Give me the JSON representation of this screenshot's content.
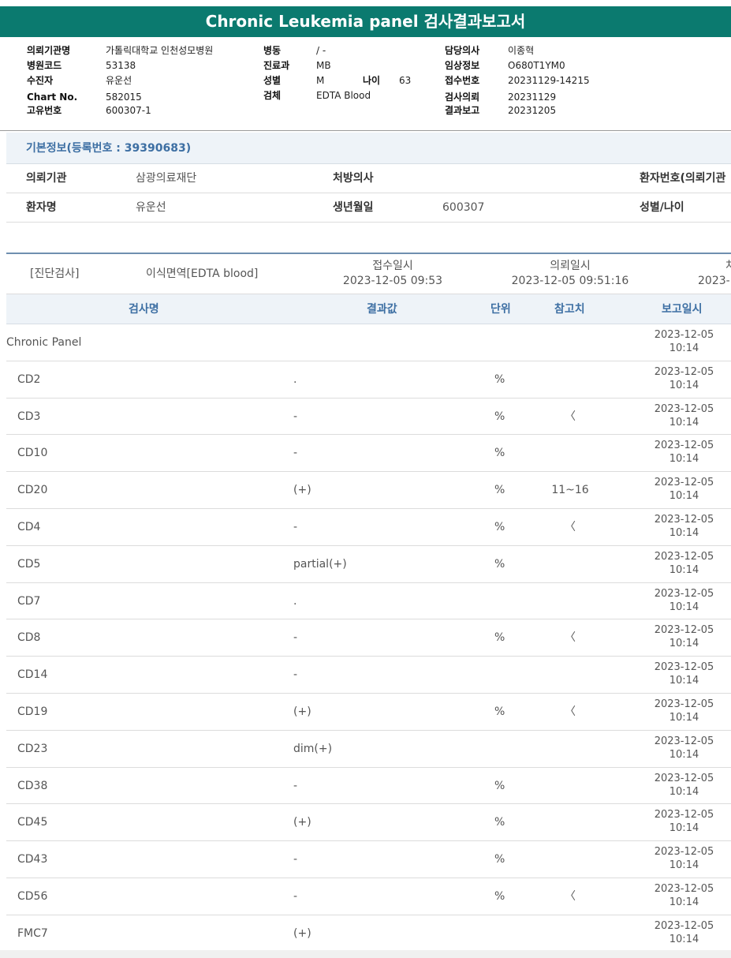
{
  "report_title": "Chronic Leukemia panel 검사결과보고서",
  "header": {
    "col1": [
      {
        "label": "의뢰기관명",
        "value": "가톨릭대학교 인천성모병원"
      },
      {
        "label": "병원코드",
        "value": "53138"
      },
      {
        "label": "수진자",
        "value": "유운선"
      },
      {
        "label": "Chart No.",
        "value": "582015"
      },
      {
        "label": "고유번호",
        "value": "600307-1"
      }
    ],
    "col2": [
      {
        "label": "병동",
        "value": "/ -"
      },
      {
        "label": "진료과",
        "value": "MB"
      },
      {
        "label": "성별",
        "value": "M"
      },
      {
        "label": "검체",
        "value": "EDTA Blood"
      }
    ],
    "age": {
      "label": "나이",
      "value": "63"
    },
    "col3": [
      {
        "label": "담당의사",
        "value": "이종혁"
      },
      {
        "label": "임상정보",
        "value": "O680T1YM0"
      },
      {
        "label": "접수번호",
        "value": "20231129-14215"
      },
      {
        "label": "검사의뢰",
        "value": "20231129"
      },
      {
        "label": "결과보고",
        "value": "20231205"
      }
    ]
  },
  "basic_info": {
    "title": "기본정보(등록번호 : 39390683)",
    "row1": {
      "label1": "의뢰기관",
      "value1": "삼광의료재단",
      "label2": "처방의사",
      "value2": "",
      "label3": "환자번호(의뢰기관"
    },
    "row2": {
      "label1": "환자명",
      "value1": "유운선",
      "label2": "생년월일",
      "value2": "600307",
      "label3": "성별/나이"
    }
  },
  "diagnosis": {
    "category": "[진단검사]",
    "dept": "이식면역[EDTA blood]",
    "received_label": "접수일시",
    "received_value": "2023-12-05 09:53",
    "requested_label": "의뢰일시",
    "requested_value": "2023-12-05 09:51:16",
    "cut_label": "처",
    "cut_value": "2023-"
  },
  "columns": {
    "name": "검사명",
    "value": "결과값",
    "unit": "단위",
    "ref": "참고치",
    "date": "보고일시"
  },
  "rows": [
    {
      "name": "Chronic Panel",
      "value": "",
      "unit": "",
      "ref": "",
      "date": "2023-12-05",
      "time": "10:14",
      "group": true
    },
    {
      "name": "CD2",
      "value": ".",
      "unit": "%",
      "ref": "",
      "date": "2023-12-05",
      "time": "10:14"
    },
    {
      "name": "CD3",
      "value": "-",
      "unit": "%",
      "ref": "〈",
      "date": "2023-12-05",
      "time": "10:14"
    },
    {
      "name": "CD10",
      "value": "-",
      "unit": "%",
      "ref": "",
      "date": "2023-12-05",
      "time": "10:14"
    },
    {
      "name": "CD20",
      "value": "(+)",
      "unit": "%",
      "ref": "11~16",
      "date": "2023-12-05",
      "time": "10:14"
    },
    {
      "name": "CD4",
      "value": "-",
      "unit": "%",
      "ref": "〈",
      "date": "2023-12-05",
      "time": "10:14"
    },
    {
      "name": "CD5",
      "value": "partial(+)",
      "unit": "%",
      "ref": "",
      "date": "2023-12-05",
      "time": "10:14"
    },
    {
      "name": "CD7",
      "value": ".",
      "unit": "",
      "ref": "",
      "date": "2023-12-05",
      "time": "10:14"
    },
    {
      "name": "CD8",
      "value": "-",
      "unit": "%",
      "ref": "〈",
      "date": "2023-12-05",
      "time": "10:14"
    },
    {
      "name": "CD14",
      "value": "-",
      "unit": "",
      "ref": "",
      "date": "2023-12-05",
      "time": "10:14"
    },
    {
      "name": "CD19",
      "value": "(+)",
      "unit": "%",
      "ref": "〈",
      "date": "2023-12-05",
      "time": "10:14"
    },
    {
      "name": "CD23",
      "value": "dim(+)",
      "unit": "",
      "ref": "",
      "date": "2023-12-05",
      "time": "10:14"
    },
    {
      "name": "CD38",
      "value": "-",
      "unit": "%",
      "ref": "",
      "date": "2023-12-05",
      "time": "10:14"
    },
    {
      "name": "CD45",
      "value": "(+)",
      "unit": "%",
      "ref": "",
      "date": "2023-12-05",
      "time": "10:14"
    },
    {
      "name": "CD43",
      "value": "-",
      "unit": "%",
      "ref": "",
      "date": "2023-12-05",
      "time": "10:14"
    },
    {
      "name": "CD56",
      "value": "-",
      "unit": "%",
      "ref": "〈",
      "date": "2023-12-05",
      "time": "10:14"
    },
    {
      "name": "FMC7",
      "value": "(+)",
      "unit": "",
      "ref": "",
      "date": "2023-12-05",
      "time": "10:14"
    }
  ]
}
